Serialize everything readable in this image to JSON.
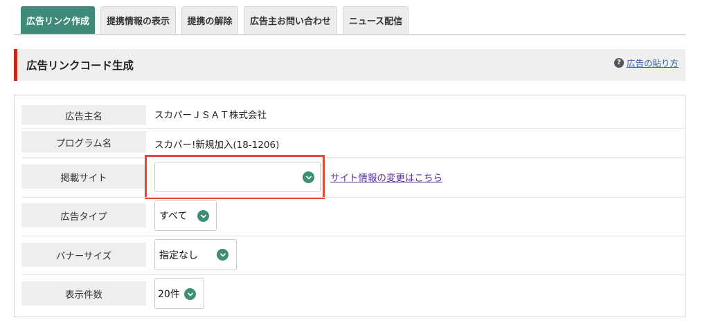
{
  "tabs": [
    {
      "label": "広告リンク作成",
      "active": true
    },
    {
      "label": "提携情報の表示",
      "active": false
    },
    {
      "label": "提携の解除",
      "active": false
    },
    {
      "label": "広告主お問い合わせ",
      "active": false
    },
    {
      "label": "ニュース配信",
      "active": false
    }
  ],
  "heading": {
    "title": "広告リンクコード生成",
    "help_label": "広告の貼り方"
  },
  "form": {
    "advertiser": {
      "label": "広告主名",
      "value": "スカパーＪＳＡＴ株式会社"
    },
    "program": {
      "label": "プログラム名",
      "value": "スカパー!新規加入(18-1206)"
    },
    "site": {
      "label": "掲載サイト",
      "selected": "",
      "link": "サイト情報の変更はこちら"
    },
    "ad_type": {
      "label": "広告タイプ",
      "selected": "すべて"
    },
    "banner_size": {
      "label": "バナーサイズ",
      "selected": "指定なし"
    },
    "per_page": {
      "label": "表示件数",
      "selected": "20件"
    }
  },
  "colors": {
    "accent_green": "#3f8a78",
    "heading_red": "#c22d1d",
    "highlight_red": "#e04a2e",
    "link_purple": "#5a2d9a"
  }
}
